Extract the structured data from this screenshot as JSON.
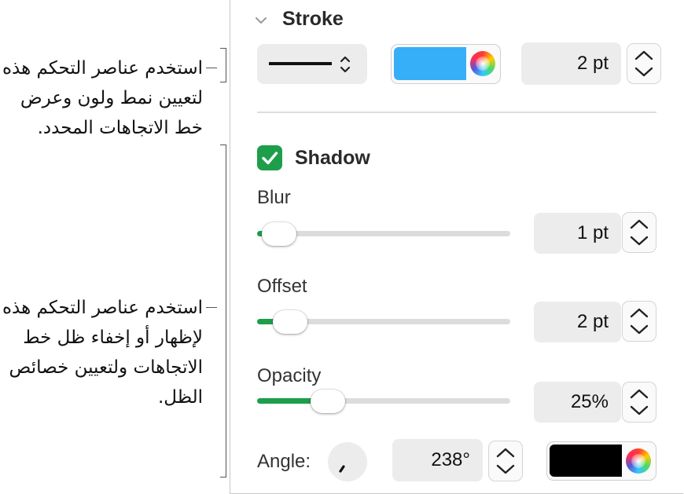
{
  "callouts": {
    "stroke_text": "استخدم عناصر التحكم هذه لتعيين نمط ولون وعرض خط الاتجاهات المحدد.",
    "shadow_text": "استخدم عناصر التحكم هذه لإظهار أو إخفاء ظل خط الاتجاهات ولتعيين خصائص الظل."
  },
  "stroke": {
    "title": "Stroke",
    "line_style": "solid",
    "color": "#37aef8",
    "width_value": "2 pt"
  },
  "shadow": {
    "checkbox_label": "Shadow",
    "checked": true,
    "blur": {
      "label": "Blur",
      "value": "1 pt",
      "level": 0.03
    },
    "offset": {
      "label": "Offset",
      "value": "2 pt",
      "level": 0.08
    },
    "opacity": {
      "label": "Opacity",
      "value": "25%",
      "level": 0.25
    },
    "angle": {
      "label": "Angle:",
      "value": "238°"
    },
    "color": "#000000"
  },
  "accent_color": "#1e9e4a"
}
